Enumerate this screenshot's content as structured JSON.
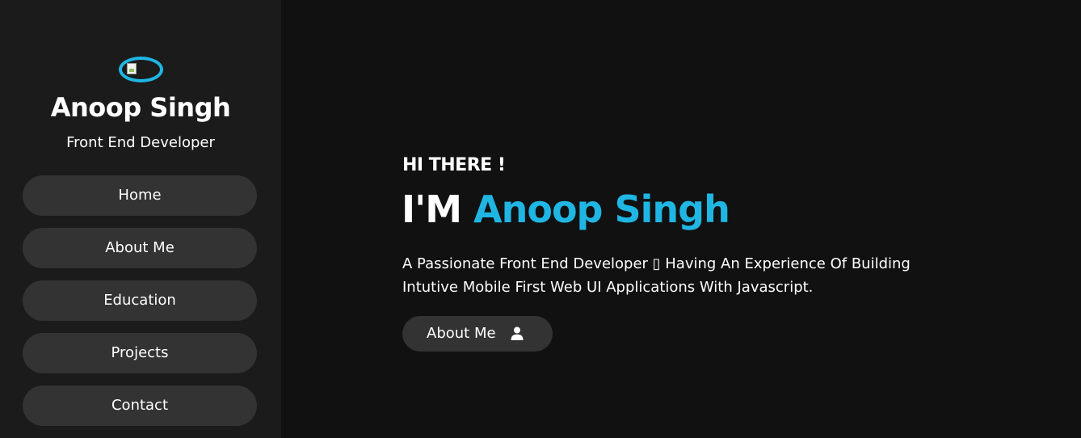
{
  "sidebar": {
    "name": "Anoop Singh",
    "role": "Front End Developer",
    "avatar_icon": "broken-image-icon",
    "nav": [
      {
        "label": "Home"
      },
      {
        "label": "About Me"
      },
      {
        "label": "Education"
      },
      {
        "label": "Projects"
      },
      {
        "label": "Contact"
      }
    ]
  },
  "hero": {
    "greeting": "HI THERE !",
    "headline_prefix": "I'M ",
    "headline_name": "Anoop Singh",
    "description_line1": "A Passionate Front End Developer ▯ Having An Experience Of Building",
    "description_line2": "Intutive Mobile First Web UI Applications With Javascript.",
    "cta_label": "About Me",
    "cta_icon": "user-icon"
  },
  "colors": {
    "accent": "#1fb6e4",
    "page_background": "#111111",
    "sidebar_background": "#1b1b1b",
    "button_background": "#333333",
    "text": "#ffffff"
  }
}
